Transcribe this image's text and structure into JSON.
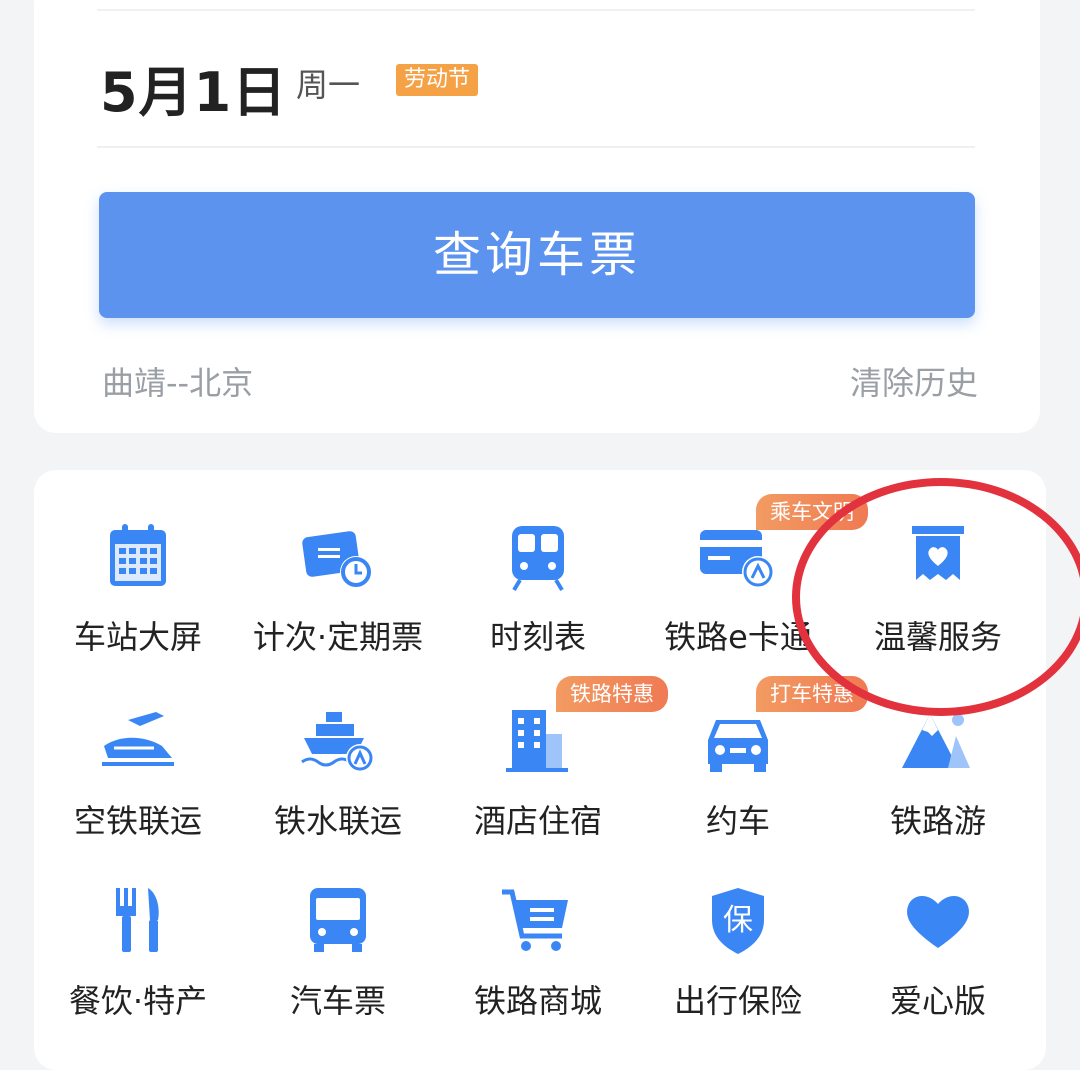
{
  "date": {
    "value": "5月1日",
    "weekday": "周一",
    "holiday": "劳动节"
  },
  "search_button": "查询车票",
  "history": {
    "route": "曲靖--北京",
    "clear": "清除历史"
  },
  "services": [
    {
      "label": "车站大屏",
      "icon": "calendar-icon"
    },
    {
      "label": "计次·定期票",
      "icon": "ticket-clock-icon"
    },
    {
      "label": "时刻表",
      "icon": "train-icon"
    },
    {
      "label": "铁路e卡通",
      "icon": "card-station-icon",
      "badge": "乘车文明"
    },
    {
      "label": "温馨服务",
      "icon": "heart-box-icon"
    },
    {
      "label": "空铁联运",
      "icon": "plane-train-icon"
    },
    {
      "label": "铁水联运",
      "icon": "ship-station-icon"
    },
    {
      "label": "酒店住宿",
      "icon": "hotel-icon",
      "badge": "铁路特惠"
    },
    {
      "label": "约车",
      "icon": "car-icon",
      "badge": "打车特惠"
    },
    {
      "label": "铁路游",
      "icon": "mountain-icon"
    },
    {
      "label": "餐饮·特产",
      "icon": "fork-knife-icon"
    },
    {
      "label": "汽车票",
      "icon": "bus-icon"
    },
    {
      "label": "铁路商城",
      "icon": "cart-icon"
    },
    {
      "label": "出行保险",
      "icon": "shield-icon",
      "shield_text": "保"
    },
    {
      "label": "爱心版",
      "icon": "heart-icon"
    }
  ],
  "colors": {
    "primary": "#5b93ef",
    "icon_blue": "#3a86f5",
    "badge_orange": "#f07a53",
    "holiday_orange": "#f5a145",
    "highlight_red": "#e2323e"
  }
}
